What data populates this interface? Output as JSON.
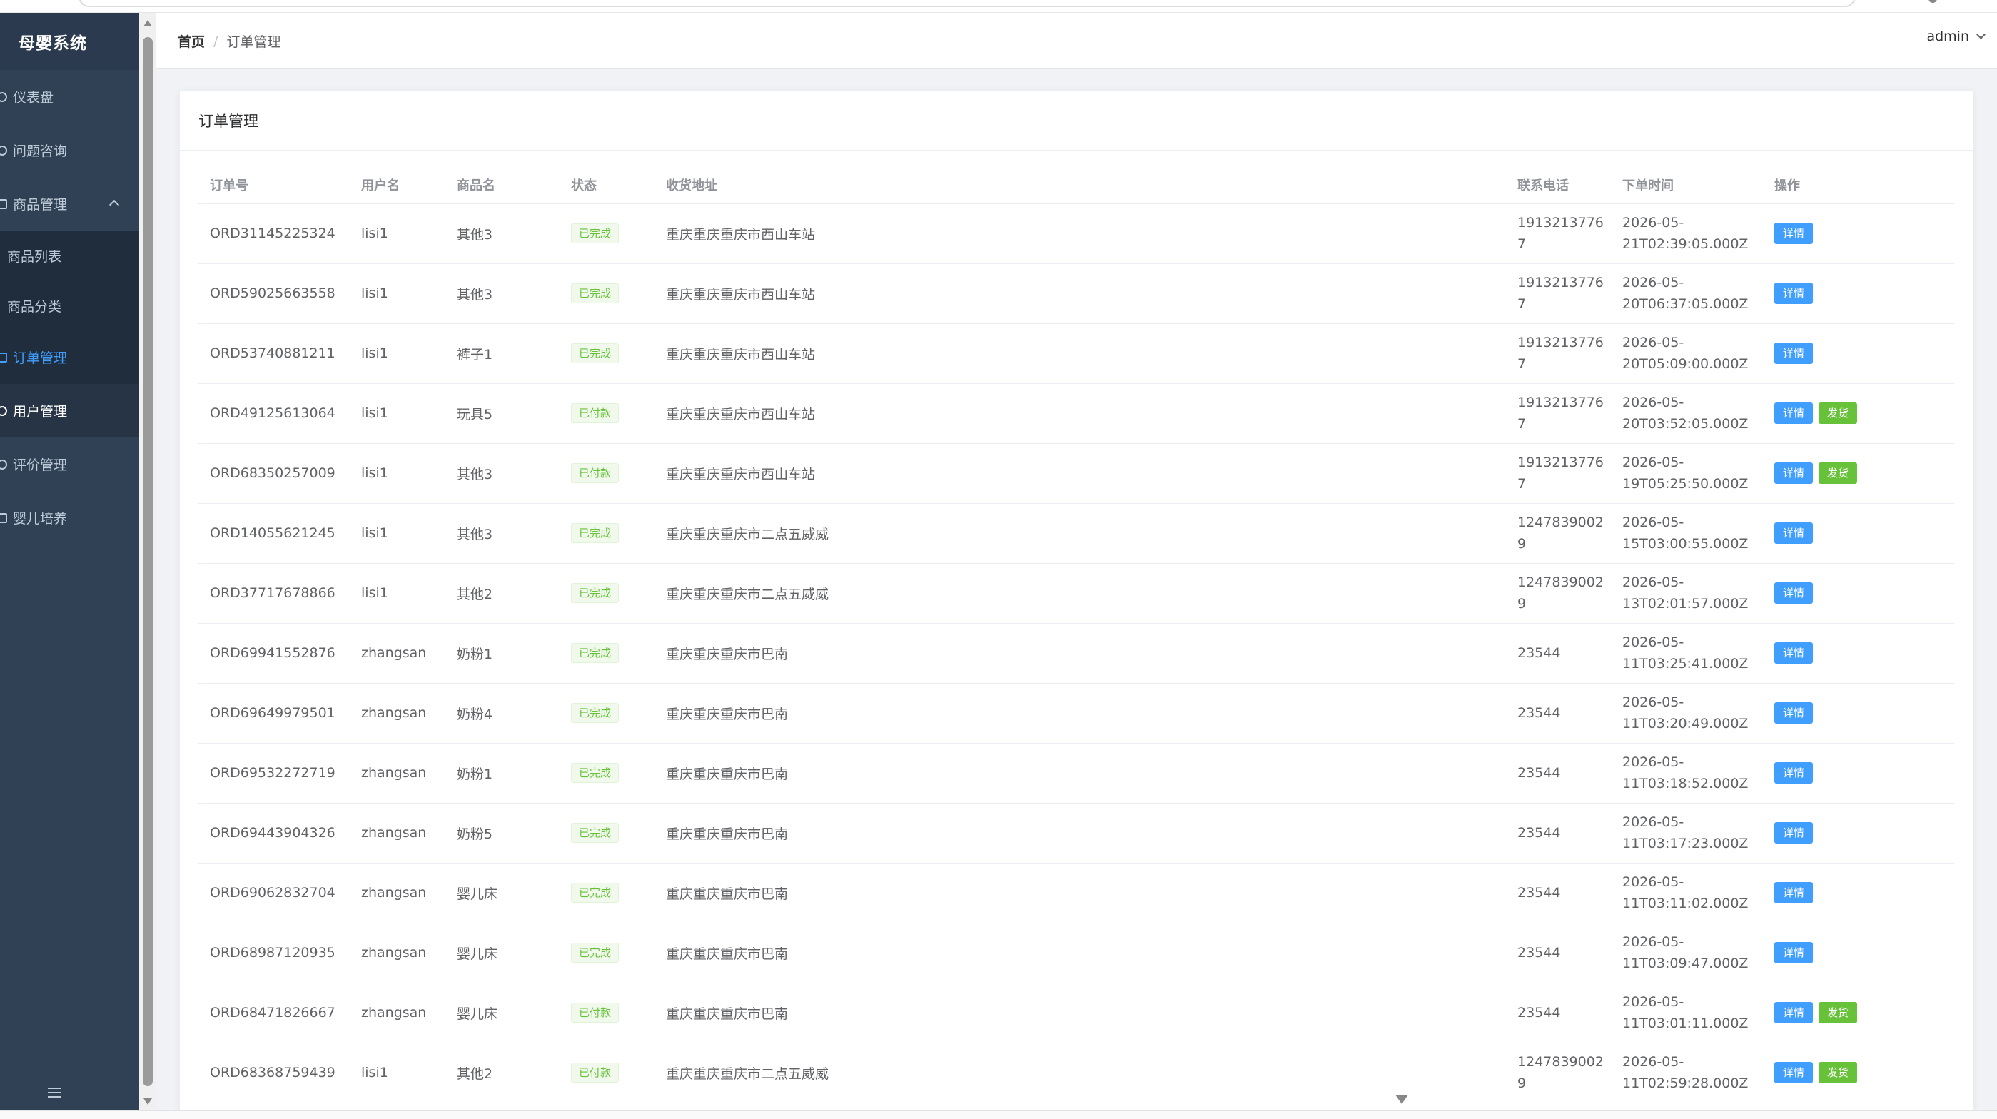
{
  "app": {
    "title": "母婴系统"
  },
  "sidebar": {
    "items": [
      {
        "label": "仪表盘"
      },
      {
        "label": "问题咨询"
      },
      {
        "label": "商品管理"
      },
      {
        "label": "商品列表"
      },
      {
        "label": "商品分类"
      },
      {
        "label": "订单管理"
      },
      {
        "label": "用户管理"
      },
      {
        "label": "评价管理"
      },
      {
        "label": "婴儿培养"
      }
    ]
  },
  "header": {
    "breadcrumb": {
      "home": "首页",
      "separator": "/",
      "current": "订单管理"
    },
    "user": "admin"
  },
  "card": {
    "title": "订单管理"
  },
  "table": {
    "columns": [
      "订单号",
      "用户名",
      "商品名",
      "状态",
      "收货地址",
      "联系电话",
      "下单时间",
      "操作"
    ],
    "detail_label": "详情",
    "ship_label": "发货",
    "rows": [
      {
        "order_no": "ORD31145225324",
        "user": "lisi1",
        "product": "其他3",
        "status": "已完成",
        "address": "重庆重庆重庆市西山车站",
        "phone_a": "1913213776",
        "phone_b": "7",
        "time_a": "2026-05-",
        "time_b": "21T02:39:05.000Z",
        "ship": false
      },
      {
        "order_no": "ORD59025663558",
        "user": "lisi1",
        "product": "其他3",
        "status": "已完成",
        "address": "重庆重庆重庆市西山车站",
        "phone_a": "1913213776",
        "phone_b": "7",
        "time_a": "2026-05-",
        "time_b": "20T06:37:05.000Z",
        "ship": false
      },
      {
        "order_no": "ORD53740881211",
        "user": "lisi1",
        "product": "裤子1",
        "status": "已完成",
        "address": "重庆重庆重庆市西山车站",
        "phone_a": "1913213776",
        "phone_b": "7",
        "time_a": "2026-05-",
        "time_b": "20T05:09:00.000Z",
        "ship": false
      },
      {
        "order_no": "ORD49125613064",
        "user": "lisi1",
        "product": "玩具5",
        "status": "已付款",
        "address": "重庆重庆重庆市西山车站",
        "phone_a": "1913213776",
        "phone_b": "7",
        "time_a": "2026-05-",
        "time_b": "20T03:52:05.000Z",
        "ship": true
      },
      {
        "order_no": "ORD68350257009",
        "user": "lisi1",
        "product": "其他3",
        "status": "已付款",
        "address": "重庆重庆重庆市西山车站",
        "phone_a": "1913213776",
        "phone_b": "7",
        "time_a": "2026-05-",
        "time_b": "19T05:25:50.000Z",
        "ship": true
      },
      {
        "order_no": "ORD14055621245",
        "user": "lisi1",
        "product": "其他3",
        "status": "已完成",
        "address": "重庆重庆重庆市二点五威威",
        "phone_a": "1247839002",
        "phone_b": "9",
        "time_a": "2026-05-",
        "time_b": "15T03:00:55.000Z",
        "ship": false
      },
      {
        "order_no": "ORD37717678866",
        "user": "lisi1",
        "product": "其他2",
        "status": "已完成",
        "address": "重庆重庆重庆市二点五威威",
        "phone_a": "1247839002",
        "phone_b": "9",
        "time_a": "2026-05-",
        "time_b": "13T02:01:57.000Z",
        "ship": false
      },
      {
        "order_no": "ORD69941552876",
        "user": "zhangsan",
        "product": "奶粉1",
        "status": "已完成",
        "address": "重庆重庆重庆市巴南",
        "phone_a": "23544",
        "phone_b": "",
        "time_a": "2026-05-",
        "time_b": "11T03:25:41.000Z",
        "ship": false
      },
      {
        "order_no": "ORD69649979501",
        "user": "zhangsan",
        "product": "奶粉4",
        "status": "已完成",
        "address": "重庆重庆重庆市巴南",
        "phone_a": "23544",
        "phone_b": "",
        "time_a": "2026-05-",
        "time_b": "11T03:20:49.000Z",
        "ship": false
      },
      {
        "order_no": "ORD69532272719",
        "user": "zhangsan",
        "product": "奶粉1",
        "status": "已完成",
        "address": "重庆重庆重庆市巴南",
        "phone_a": "23544",
        "phone_b": "",
        "time_a": "2026-05-",
        "time_b": "11T03:18:52.000Z",
        "ship": false
      },
      {
        "order_no": "ORD69443904326",
        "user": "zhangsan",
        "product": "奶粉5",
        "status": "已完成",
        "address": "重庆重庆重庆市巴南",
        "phone_a": "23544",
        "phone_b": "",
        "time_a": "2026-05-",
        "time_b": "11T03:17:23.000Z",
        "ship": false
      },
      {
        "order_no": "ORD69062832704",
        "user": "zhangsan",
        "product": "婴儿床",
        "status": "已完成",
        "address": "重庆重庆重庆市巴南",
        "phone_a": "23544",
        "phone_b": "",
        "time_a": "2026-05-",
        "time_b": "11T03:11:02.000Z",
        "ship": false
      },
      {
        "order_no": "ORD68987120935",
        "user": "zhangsan",
        "product": "婴儿床",
        "status": "已完成",
        "address": "重庆重庆重庆市巴南",
        "phone_a": "23544",
        "phone_b": "",
        "time_a": "2026-05-",
        "time_b": "11T03:09:47.000Z",
        "ship": false
      },
      {
        "order_no": "ORD68471826667",
        "user": "zhangsan",
        "product": "婴儿床",
        "status": "已付款",
        "address": "重庆重庆重庆市巴南",
        "phone_a": "23544",
        "phone_b": "",
        "time_a": "2026-05-",
        "time_b": "11T03:01:11.000Z",
        "ship": true
      },
      {
        "order_no": "ORD68368759439",
        "user": "lisi1",
        "product": "其他2",
        "status": "已付款",
        "address": "重庆重庆重庆市二点五威威",
        "phone_a": "1247839002",
        "phone_b": "9",
        "time_a": "2026-05-",
        "time_b": "11T02:59:28.000Z",
        "ship": true
      }
    ]
  },
  "colors": {
    "sidebar_bg": "#304156",
    "active_text": "#409eff",
    "primary_button": "#409eff",
    "success": "#67c23a"
  },
  "icons": {
    "dashboard": "dashboard-icon",
    "question": "question-icon",
    "goods": "goods-icon",
    "order": "order-icon",
    "user": "user-icon",
    "review": "review-icon",
    "baby": "baby-icon",
    "collapse": "hamburger-icon"
  }
}
